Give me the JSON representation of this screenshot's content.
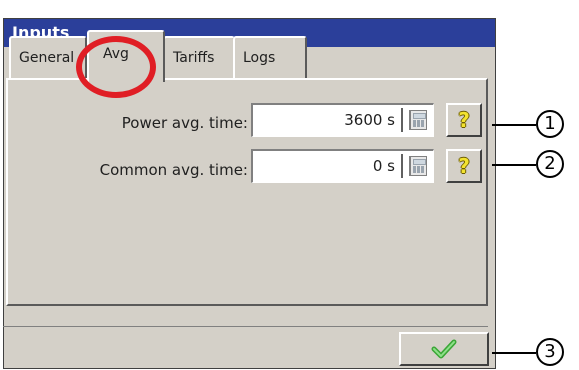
{
  "window": {
    "title": "Inputs",
    "title_bar_color": "#2b3f9a"
  },
  "tabs": [
    {
      "label": "General",
      "active": false
    },
    {
      "label": "Avg",
      "active": true
    },
    {
      "label": "Tariffs",
      "active": false
    },
    {
      "label": "Logs",
      "active": false
    }
  ],
  "fields": [
    {
      "label": "Power avg. time:",
      "value": "3600 s",
      "help_icon": "question-icon",
      "keypad_icon": "calculator-icon"
    },
    {
      "label": "Common avg. time:",
      "value": "0 s",
      "help_icon": "question-icon",
      "keypad_icon": "calculator-icon"
    }
  ],
  "footer": {
    "ok_icon": "checkmark-icon"
  },
  "annotations": {
    "highlight_color": "#e01e25",
    "callouts": [
      "1",
      "2",
      "3"
    ]
  }
}
